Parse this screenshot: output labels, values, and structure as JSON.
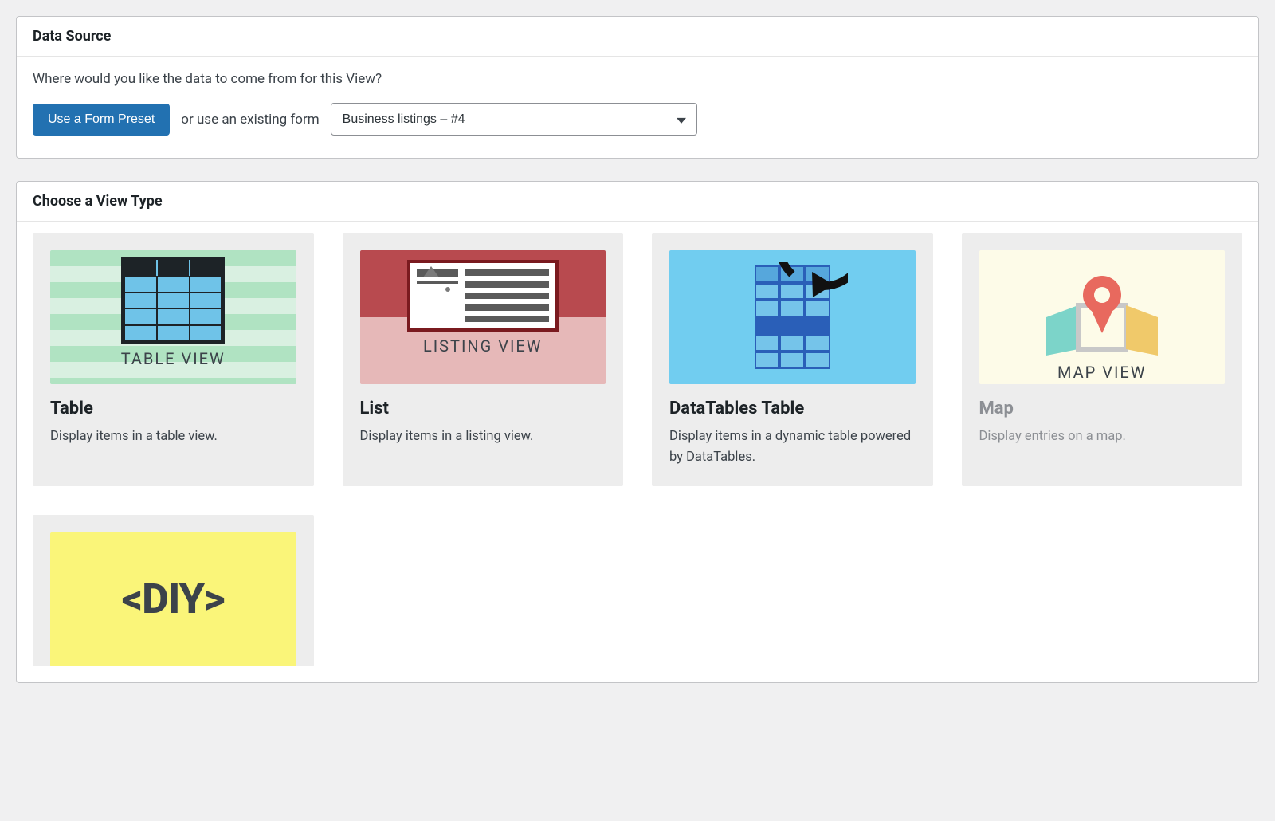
{
  "dataSource": {
    "title": "Data Source",
    "prompt": "Where would you like the data to come from for this View?",
    "preset_button": "Use a Form Preset",
    "or_text": "or use an existing form",
    "selected_form": "Business listings – #4"
  },
  "viewType": {
    "title": "Choose a View Type",
    "options": [
      {
        "label": "Table",
        "desc": "Display items in a table view.",
        "thumb_label": "TABLE VIEW"
      },
      {
        "label": "List",
        "desc": "Display items in a listing view.",
        "thumb_label": "LISTING VIEW"
      },
      {
        "label": "DataTables Table",
        "desc": "Display items in a dynamic table powered by DataTables."
      },
      {
        "label": "Map",
        "desc": "Display entries on a map.",
        "thumb_label": "MAP VIEW"
      },
      {
        "label_tag": "<DIY>"
      }
    ]
  }
}
